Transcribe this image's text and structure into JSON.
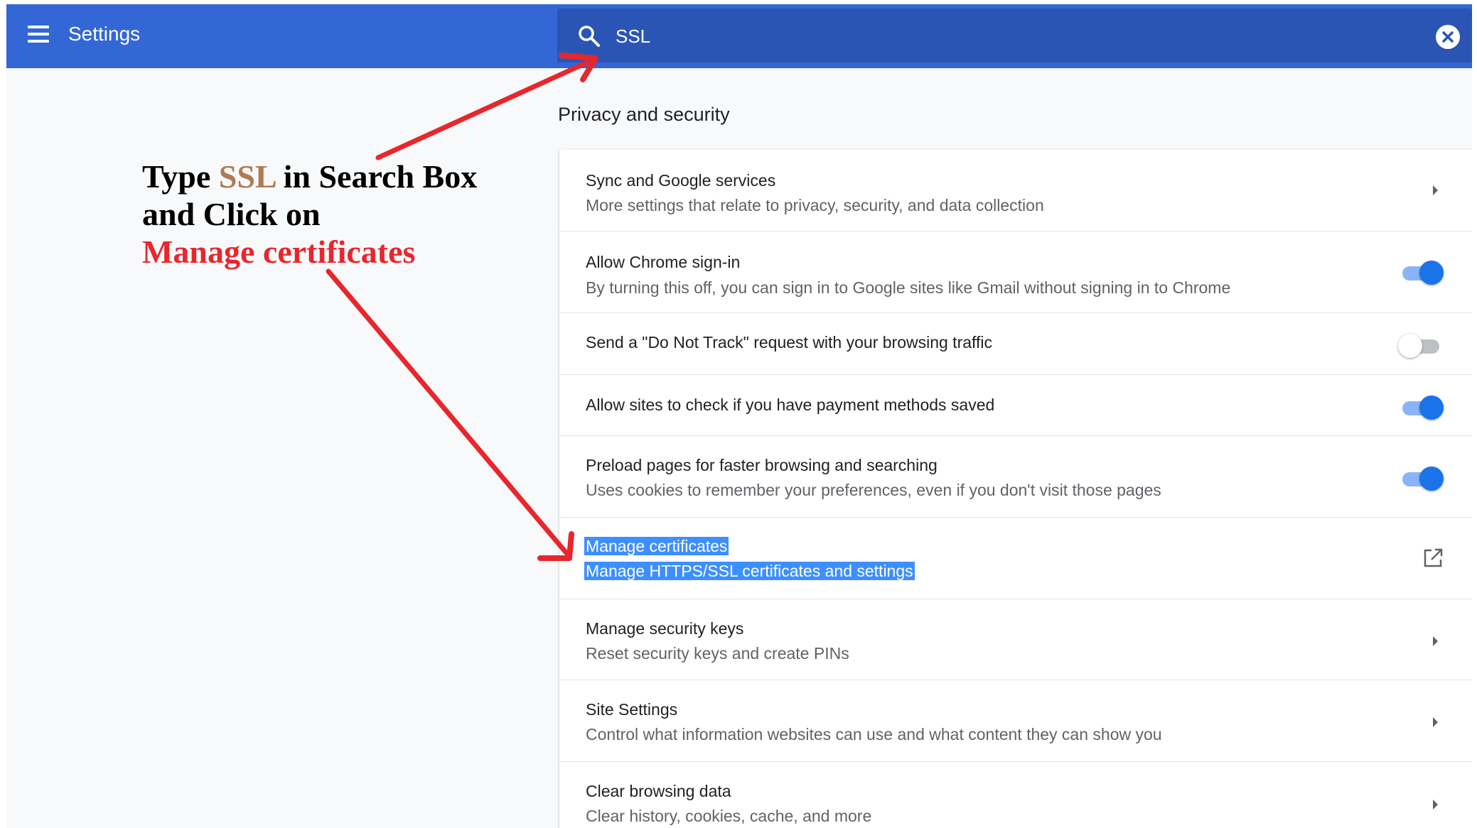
{
  "topbar": {
    "title": "Settings",
    "search_value": "SSL",
    "icons": {
      "menu": "hamburger-menu-icon",
      "search": "search-icon",
      "clear": "clear-search-icon"
    }
  },
  "section": {
    "title": "Privacy and security",
    "rows": [
      {
        "title": "Sync and Google services",
        "subtitle": "More settings that relate to privacy, security, and data collection",
        "control": "chevron"
      },
      {
        "title": "Allow Chrome sign-in",
        "subtitle": "By turning this off, you can sign in to Google sites like Gmail without signing in to Chrome",
        "control": "toggle",
        "on": true
      },
      {
        "title": "Send a \"Do Not Track\" request with your browsing traffic",
        "control": "toggle",
        "on": false
      },
      {
        "title": "Allow sites to check if you have payment methods saved",
        "control": "toggle",
        "on": true
      },
      {
        "title": "Preload pages for faster browsing and searching",
        "subtitle": "Uses cookies to remember your preferences, even if you don't visit those pages",
        "control": "toggle",
        "on": true
      },
      {
        "title": "Manage certificates",
        "subtitle": "Manage HTTPS/SSL certificates and settings",
        "control": "external-link",
        "highlighted": true
      },
      {
        "title": "Manage security keys",
        "subtitle": "Reset security keys and create PINs",
        "control": "chevron"
      },
      {
        "title": "Site Settings",
        "subtitle": "Control what information websites can use and what content they can show you",
        "control": "chevron"
      },
      {
        "title": "Clear browsing data",
        "subtitle": "Clear history, cookies, cache, and more",
        "control": "chevron"
      }
    ]
  },
  "annotation": {
    "part1": "Type ",
    "ssl": "SSL",
    "part2": " in Search Box",
    "line2": "and Click on",
    "line3": "Manage certificates"
  },
  "colors": {
    "topbar": "#3367d6",
    "search_box": "#2a55b4",
    "toggle_on": "#1a73e8",
    "highlight": "#3d8fff",
    "annotation_red": "#e8262d",
    "annotation_ssl": "#b07a54"
  }
}
